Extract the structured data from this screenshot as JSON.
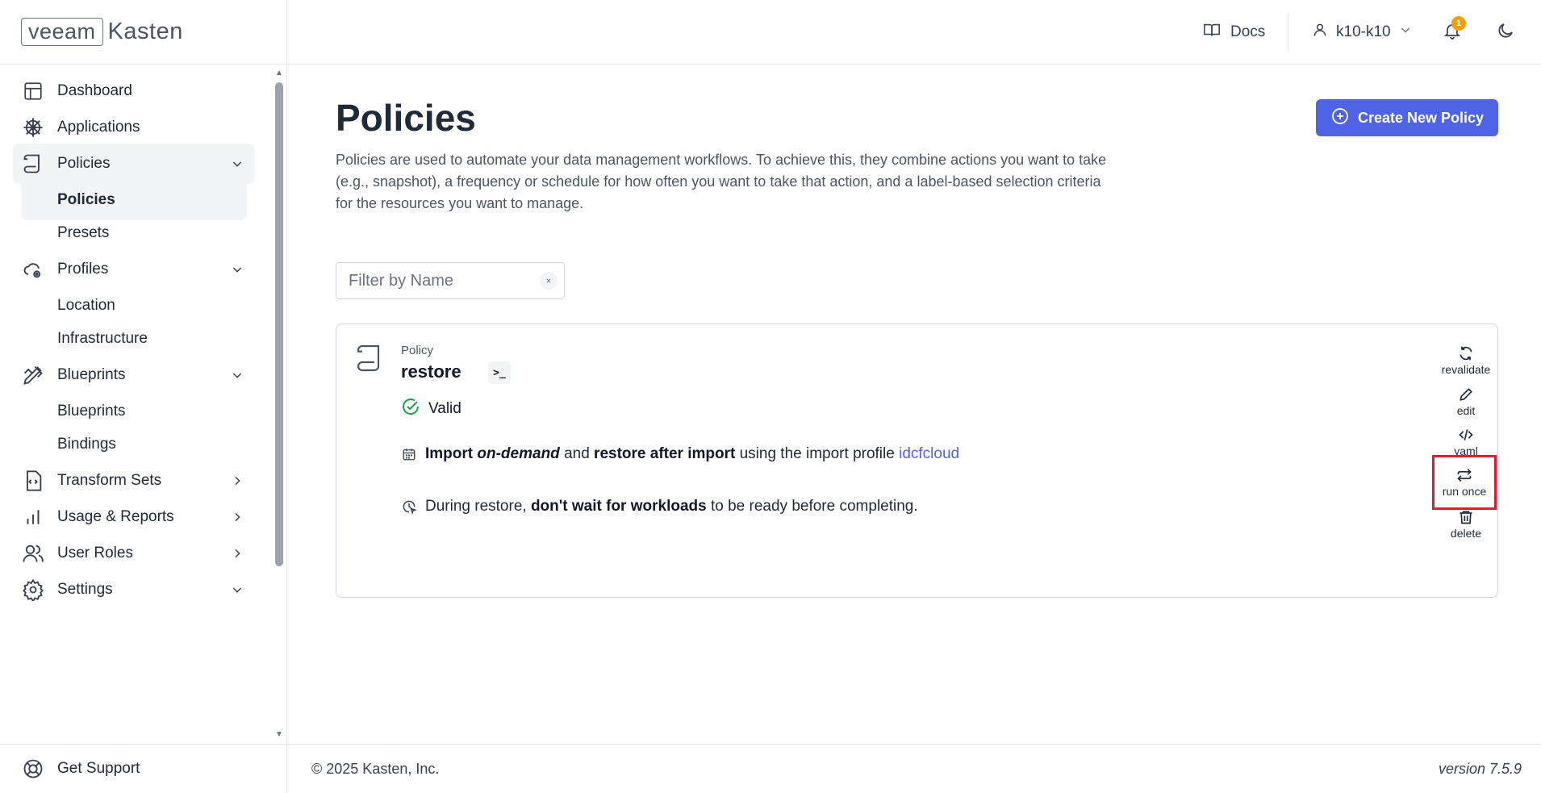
{
  "brand": {
    "logo_part1": "veeam",
    "logo_part2": "Kasten"
  },
  "header": {
    "docs_label": "Docs",
    "user_label": "k10-k10",
    "notification_count": "1"
  },
  "sidebar": {
    "items": [
      {
        "label": "Dashboard"
      },
      {
        "label": "Applications"
      },
      {
        "label": "Policies"
      },
      {
        "label": "Profiles"
      },
      {
        "label": "Blueprints"
      },
      {
        "label": "Transform Sets"
      },
      {
        "label": "Usage & Reports"
      },
      {
        "label": "User Roles"
      },
      {
        "label": "Settings"
      }
    ],
    "sub_policies": [
      "Policies",
      "Presets"
    ],
    "sub_profiles": [
      "Location",
      "Infrastructure"
    ],
    "sub_blueprints": [
      "Blueprints",
      "Bindings"
    ],
    "support_label": "Get Support"
  },
  "main": {
    "title": "Policies",
    "description": "Policies are used to automate your data management workflows. To achieve this, they combine actions you want to take (e.g., snapshot), a frequency or schedule for how often you want to take that action, and a label-based selection criteria for the resources you want to manage.",
    "create_button": "Create New Policy",
    "filter_placeholder": "Filter by Name",
    "filter_clear": "×"
  },
  "policy_card": {
    "kind": "Policy",
    "name": "restore",
    "terminal_glyph": ">_",
    "status": "Valid",
    "line1": {
      "w1": "Import",
      "w2": "on-demand",
      "w3": "and",
      "w4": "restore after import",
      "w5": "using the import profile",
      "link": "idcfcloud"
    },
    "line2": {
      "w1": "During restore,",
      "w2": "don't wait for workloads",
      "w3": "to be ready before completing."
    },
    "actions": [
      "revalidate",
      "edit",
      "yaml",
      "run once",
      "delete"
    ]
  },
  "footer": {
    "copyright": "© 2025 Kasten, Inc.",
    "version": "version 7.5.9"
  },
  "colors": {
    "accent": "#4f63e7",
    "valid": "#16a34a",
    "badge": "#f59e0b",
    "highlight": "#e11d2e"
  }
}
